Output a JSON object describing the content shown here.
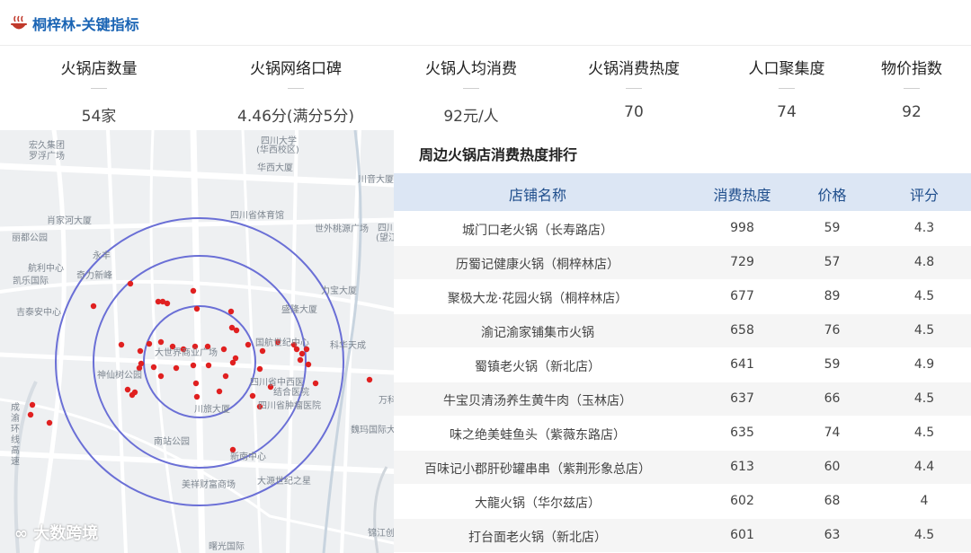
{
  "header": {
    "title": "桐梓林-关键指标"
  },
  "kpis": [
    {
      "label": "火锅店数量",
      "value": "54家"
    },
    {
      "label": "火锅网络口碑",
      "value": "4.46分(满分5分)"
    },
    {
      "label": "火锅人均消费",
      "value": "92元/人"
    },
    {
      "label": "火锅消费热度",
      "value": "70"
    },
    {
      "label": "人口聚集度",
      "value": "74"
    },
    {
      "label": "物价指数",
      "value": "92"
    }
  ],
  "map": {
    "labels": [
      "宏久集团",
      "罗浮广场",
      "四川大学",
      "(华西校区)",
      "华西大厦",
      "川音大厦",
      "四川省体育馆",
      "世外桃源广场",
      "四川",
      "(望江",
      "肖家河大厦",
      "丽都公园",
      "永丰",
      "航利中心",
      "凯乐国际",
      "奇力新峰",
      "力宝大厦",
      "吉泰安中心",
      "盛隆大厦",
      "科华天成",
      "大世界商业广场",
      "国航世纪中心",
      "神仙树公园",
      "四川省中西医",
      "结合医院",
      "四川省肿瘤医院",
      "万科",
      "川旅大厦",
      "魏玛国际大厦",
      "南站公园",
      "新南中心",
      "大源世纪之星",
      "美祥财富商场",
      "锦江创",
      "曙光国际"
    ],
    "vertical_label": "成渝环线高速",
    "watermark": "大数跨境",
    "marker_color": "#e02020",
    "ring_color": "#6a6fd6"
  },
  "ranking": {
    "title": "周边火锅店消费热度排行",
    "columns": [
      "店铺名称",
      "消费热度",
      "价格",
      "评分"
    ],
    "rows": [
      [
        "城门口老火锅（长寿路店）",
        "998",
        "59",
        "4.3"
      ],
      [
        "历蜀记健康火锅（桐梓林店）",
        "729",
        "57",
        "4.8"
      ],
      [
        "聚极大龙·花园火锅（桐梓林店）",
        "677",
        "89",
        "4.5"
      ],
      [
        "渝记渝家铺集市火锅",
        "658",
        "76",
        "4.5"
      ],
      [
        "蜀镇老火锅（新北店）",
        "641",
        "59",
        "4.9"
      ],
      [
        "牛宝贝清汤养生黄牛肉（玉林店）",
        "637",
        "66",
        "4.5"
      ],
      [
        "味之绝美蛙鱼头（紫薇东路店）",
        "635",
        "74",
        "4.5"
      ],
      [
        "百味记小郡肝砂罐串串（紫荆形象总店）",
        "613",
        "60",
        "4.4"
      ],
      [
        "大龍火锅（华尔兹店）",
        "602",
        "68",
        "4"
      ],
      [
        "打台面老火锅（新北店）",
        "601",
        "63",
        "4.5"
      ]
    ]
  }
}
